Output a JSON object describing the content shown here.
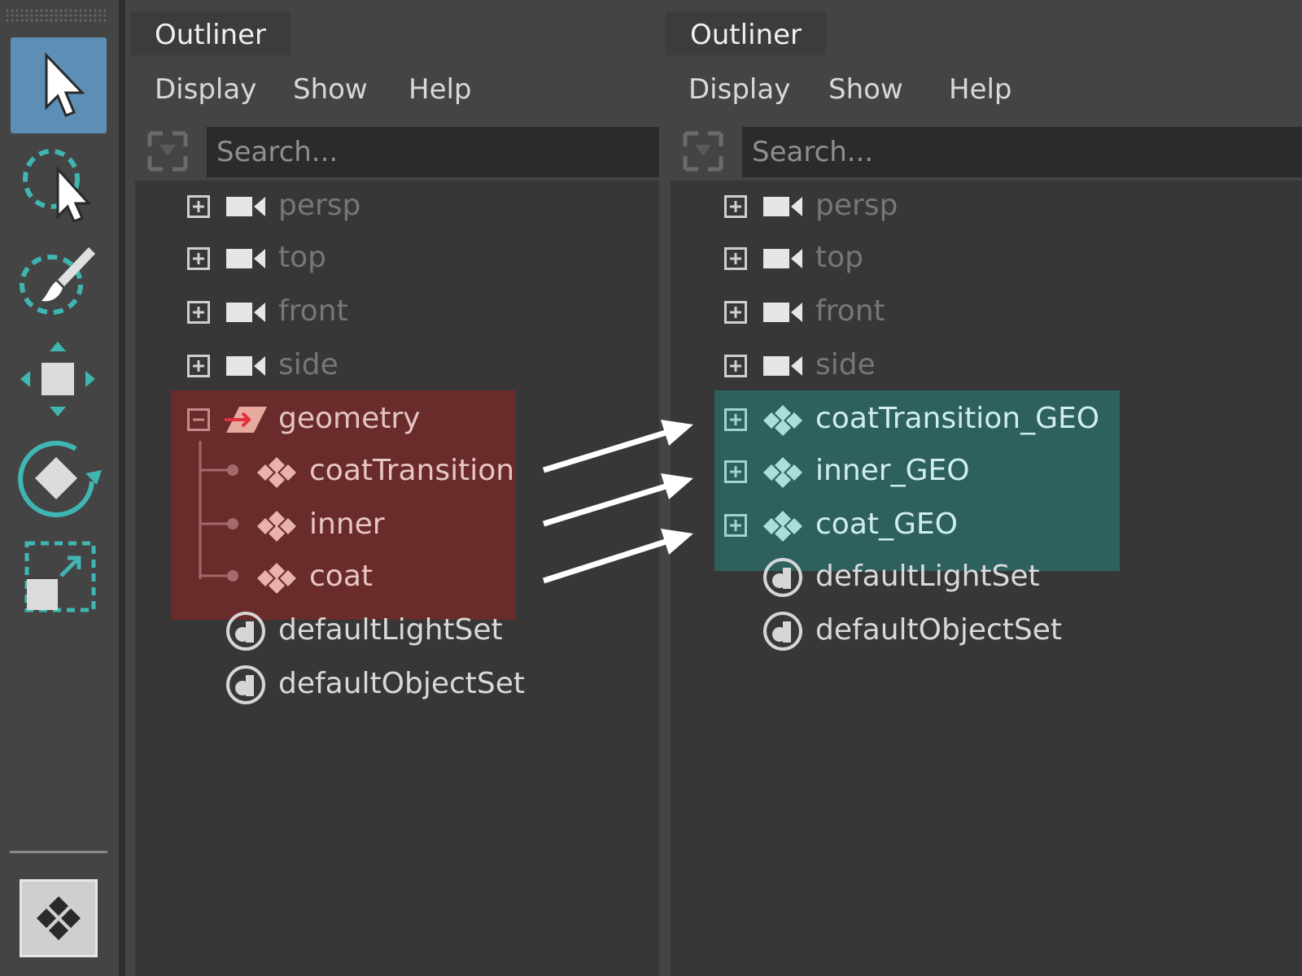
{
  "toolbox": {
    "tools": [
      {
        "name": "select-tool",
        "icon": "arrow-cursor-icon",
        "active": true
      },
      {
        "name": "lasso-tool",
        "icon": "lasso-select-icon",
        "active": false
      },
      {
        "name": "paint-select-tool",
        "icon": "paint-brush-select-icon",
        "active": false
      },
      {
        "name": "move-tool",
        "icon": "move-arrows-icon",
        "active": false
      },
      {
        "name": "rotate-tool",
        "icon": "rotate-icon",
        "active": false
      },
      {
        "name": "scale-tool",
        "icon": "scale-icon",
        "active": false
      }
    ],
    "bottom_icon": "mesh-display-icon"
  },
  "left_outliner": {
    "tab": "Outliner",
    "menus": [
      "Display",
      "Show",
      "Help"
    ],
    "search_placeholder": "Search...",
    "rows": [
      {
        "label": "persp",
        "icon": "camera-icon",
        "expander": "plus",
        "dimmed": true
      },
      {
        "label": "top",
        "icon": "camera-icon",
        "expander": "plus",
        "dimmed": true
      },
      {
        "label": "front",
        "icon": "camera-icon",
        "expander": "plus",
        "dimmed": true
      },
      {
        "label": "side",
        "icon": "camera-icon",
        "expander": "plus",
        "dimmed": true
      },
      {
        "label": "geometry",
        "icon": "group-transform-icon",
        "expander": "minus",
        "dimmed": false
      },
      {
        "label": "coatTransition",
        "icon": "mesh-icon",
        "expander": "none",
        "dimmed": false
      },
      {
        "label": "inner",
        "icon": "mesh-icon",
        "expander": "none",
        "dimmed": false
      },
      {
        "label": "coat",
        "icon": "mesh-icon",
        "expander": "none",
        "dimmed": false
      },
      {
        "label": "defaultLightSet",
        "icon": "set-icon",
        "expander": "none",
        "dimmed": false
      },
      {
        "label": "defaultObjectSet",
        "icon": "set-icon",
        "expander": "none",
        "dimmed": false
      }
    ]
  },
  "right_outliner": {
    "tab": "Outliner",
    "menus": [
      "Display",
      "Show",
      "Help"
    ],
    "search_placeholder": "Search...",
    "rows": [
      {
        "label": "persp",
        "icon": "camera-icon",
        "expander": "plus",
        "dimmed": true
      },
      {
        "label": "top",
        "icon": "camera-icon",
        "expander": "plus",
        "dimmed": true
      },
      {
        "label": "front",
        "icon": "camera-icon",
        "expander": "plus",
        "dimmed": true
      },
      {
        "label": "side",
        "icon": "camera-icon",
        "expander": "plus",
        "dimmed": true
      },
      {
        "label": "coatTransition_GEO",
        "icon": "mesh-icon",
        "expander": "plus",
        "dimmed": false
      },
      {
        "label": "inner_GEO",
        "icon": "mesh-icon",
        "expander": "plus",
        "dimmed": false
      },
      {
        "label": "coat_GEO",
        "icon": "mesh-icon",
        "expander": "plus",
        "dimmed": false
      },
      {
        "label": "defaultLightSet",
        "icon": "set-icon",
        "expander": "none",
        "dimmed": false
      },
      {
        "label": "defaultObjectSet",
        "icon": "set-icon",
        "expander": "none",
        "dimmed": false
      }
    ]
  },
  "colors": {
    "highlight_red": "#6a2b2b",
    "highlight_teal": "#2e6060",
    "annotation_arrow": "#ffffff"
  }
}
